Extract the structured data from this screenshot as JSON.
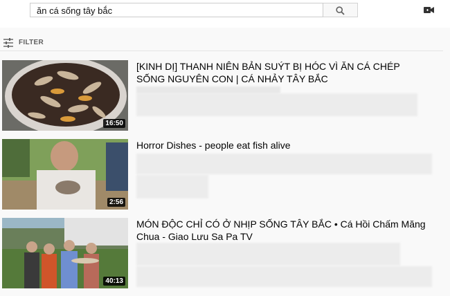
{
  "search": {
    "query": "ăn cá sống tây bắc",
    "button_icon": "search-icon"
  },
  "topbar": {
    "upload_icon": "video-camera-icon"
  },
  "filter": {
    "label": "FILTER",
    "icon": "filter-sliders-icon"
  },
  "results": [
    {
      "title": "[KINH DỊ] THANH NIÊN BẢN SUÝT BỊ HÓC VÌ ĂN CÁ CHÉP SỐNG NGUYÊN CON | CÁ NHẢY TÂY BẮC",
      "duration": "16:50"
    },
    {
      "title": "Horror Dishes - people eat fish alive",
      "duration": "2:56"
    },
    {
      "title": "MÓN ĐỘC CHỈ CÓ Ở NHỊP SỐNG TÂY BẮC • Cá Hồi Chấm Măng Chua - Giao Lưu Sa Pa TV",
      "duration": "40:13"
    }
  ]
}
